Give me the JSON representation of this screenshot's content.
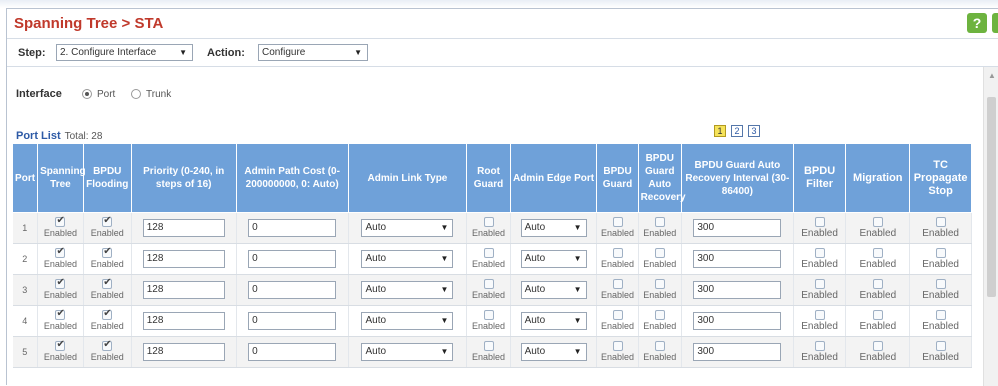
{
  "title": "Spanning Tree > STA",
  "step": {
    "label": "Step:",
    "value": "2. Configure Interface"
  },
  "action": {
    "label": "Action:",
    "value": "Configure"
  },
  "interface": {
    "label": "Interface",
    "options": [
      "Port",
      "Trunk"
    ],
    "selected": "Port"
  },
  "port_list": {
    "label": "Port List",
    "total": "Total: 28"
  },
  "pages": [
    "1",
    "2",
    "3"
  ],
  "current_page": "1",
  "columns": {
    "port": "Port",
    "spanning_tree": "Spanning Tree",
    "bpdu_flooding": "BPDU Flooding",
    "priority": "Priority (0-240, in steps of 16)",
    "admin_path_cost": "Admin Path Cost (0-200000000, 0: Auto)",
    "admin_link_type": "Admin Link Type",
    "root_guard": "Root Guard",
    "admin_edge_port": "Admin Edge Port",
    "bpdu_guard": "BPDU Guard",
    "bpdu_guard_auto_recovery": "BPDU Guard Auto Recovery",
    "bpdu_guard_interval": "BPDU Guard Auto Recovery Interval (30-86400)",
    "bpdu_filter": "BPDU Filter",
    "migration": "Migration",
    "tc_propagate_stop": "TC Propagate Stop"
  },
  "enabled_label": "Enabled",
  "rows": [
    {
      "port": "1",
      "priority": "128",
      "path_cost": "0",
      "link_type": "Auto",
      "edge_port": "Auto",
      "interval": "300"
    },
    {
      "port": "2",
      "priority": "128",
      "path_cost": "0",
      "link_type": "Auto",
      "edge_port": "Auto",
      "interval": "300"
    },
    {
      "port": "3",
      "priority": "128",
      "path_cost": "0",
      "link_type": "Auto",
      "edge_port": "Auto",
      "interval": "300"
    },
    {
      "port": "4",
      "priority": "128",
      "path_cost": "0",
      "link_type": "Auto",
      "edge_port": "Auto",
      "interval": "300"
    },
    {
      "port": "5",
      "priority": "128",
      "path_cost": "0",
      "link_type": "Auto",
      "edge_port": "Auto",
      "interval": "300"
    }
  ],
  "colors": {
    "title": "#c0392b",
    "header_bg": "#6fa1d9",
    "link": "#2d5aa6",
    "help": "#6db33f"
  }
}
